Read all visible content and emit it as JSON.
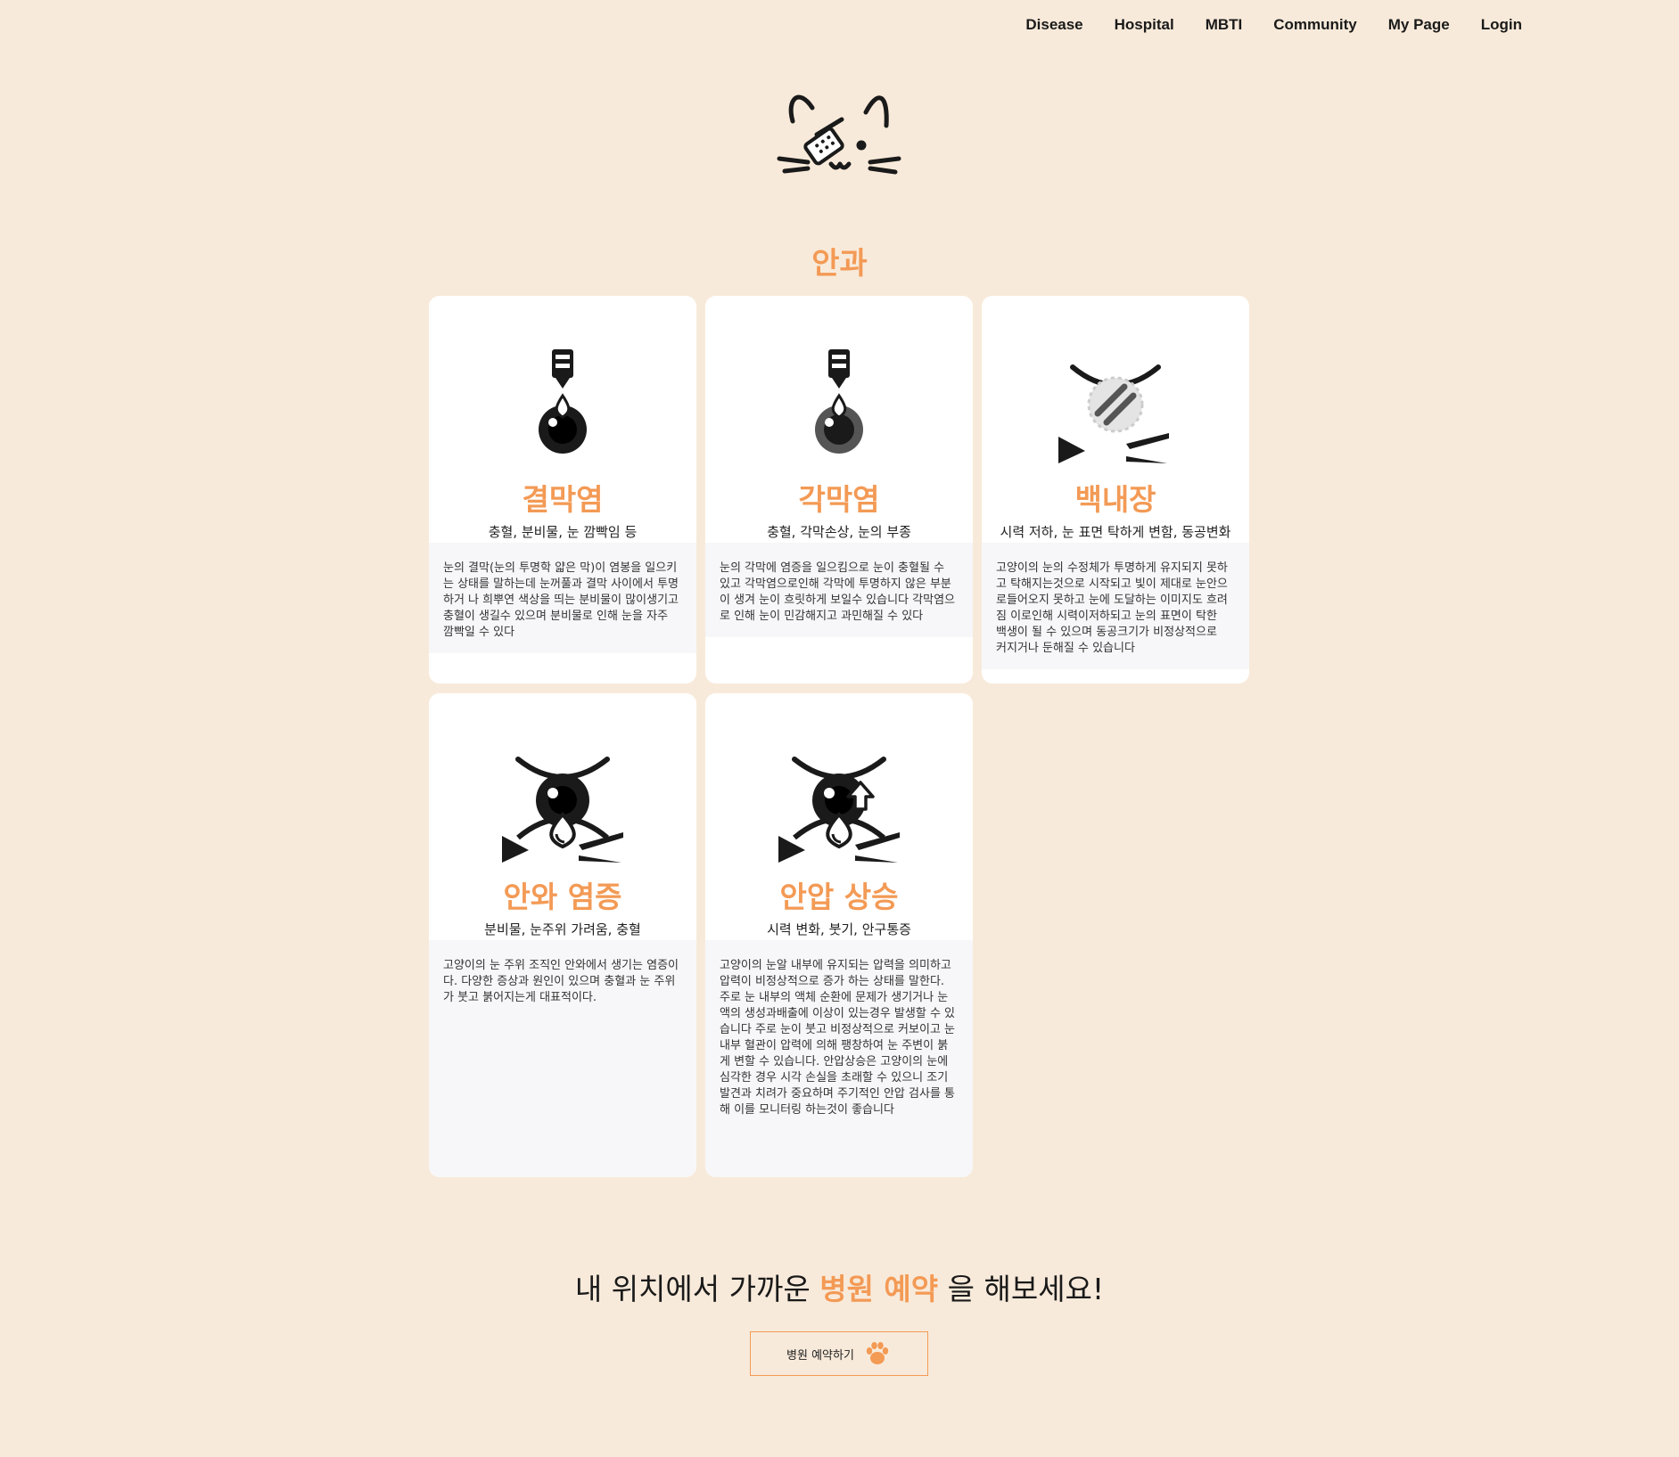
{
  "nav": {
    "items": [
      "Disease",
      "Hospital",
      "MBTI",
      "Community",
      "My Page",
      "Login"
    ]
  },
  "section_title": "안과",
  "cards": [
    {
      "name": "결막염",
      "symptoms": "충혈, 분비물, 눈 깜빡임 등",
      "description": "눈의 결막(눈의 투명학 얇은 막)이 염봉을 일으키는 상태를 말하는데 눈꺼풀과 결막 사이에서 투명하거 나 희뿌연 색상을 띄는 분비물이 많이생기고 충혈이 생길수 있으며 분비물로 인해 눈을 자주 깜빡일 수 있다",
      "icon": "eye-drop-icon"
    },
    {
      "name": "각막염",
      "symptoms": "충혈, 각막손상, 눈의 부종",
      "description": "눈의 각막에 염증을 일으킴으로 눈이 충혈될 수 있고 각막염으로인해 각막에 투명하지 않은 부분이 생겨 눈이 흐릿하게 보일수 있습니다 각막염으로 인해 눈이 민감해지고 과민해질 수 있다",
      "icon": "eye-drop-gray-icon"
    },
    {
      "name": "백내장",
      "symptoms": "시력 저하, 눈 표면 탁하게 변함, 동공변화",
      "description": "고양이의 눈의 수정체가 투명하게 유지되지 못하고 탁해지는것으로 시작되고 빛이 제대로 눈안으로들어오지 못하고 눈에 도달하는 이미지도 흐려짐 이로인해 시력이저하되고 눈의 표면이 탁한 백생이 될 수 있으며 동공크기가 비정상적으로 커지거나 둔해질 수 있습니다",
      "icon": "cloudy-eye-icon"
    },
    {
      "name": "안와 염증",
      "symptoms": "분비물, 눈주위 가려움, 충혈",
      "description": "고양이의 눈 주위 조직인 안와에서 생기는 염증이다. 다양한 증상과 원인이 있으며 충혈과 눈 주위가 붓고 붉어지는게 대표적이다.",
      "icon": "teary-eye-icon"
    },
    {
      "name": "안압 상승",
      "symptoms": "시력 변화, 붓기, 안구통증",
      "description": "고양이의 눈알 내부에 유지되는 압력을 의미하고 압력이 비정상적으로 증가 하는 상태를 말한다. 주로 눈 내부의 액체 순환에 문제가 생기거나 눈액의 생성과배출에 이상이 있는경우 발생할 수 있습니다 주로 눈이 붓고 비정상적으로 커보이고 눈 내부 혈관이 압력에 의해 팽창하여 눈 주변이 붉게 변할 수 있습니다. 안압상승은 고양이의 눈에 심각한 경우 시각 손실을 초래할 수 있으니 조기 발견과 치려가 중요하며 주기적인 안압 검사를 통해 이를 모니터링 하는것이 좋습니다",
      "icon": "pressure-eye-icon"
    }
  ],
  "cta": {
    "prefix": "내 위치에서 가까운 ",
    "highlight": "병원 예약",
    "suffix": " 을 해보세요!"
  },
  "button": {
    "label": "병원 예약하기",
    "icon": "paw-icon"
  },
  "colors": {
    "background": "#f8eada",
    "accent": "#f39a55",
    "card": "#ffffff",
    "card_desc": "#f7f7f9"
  }
}
